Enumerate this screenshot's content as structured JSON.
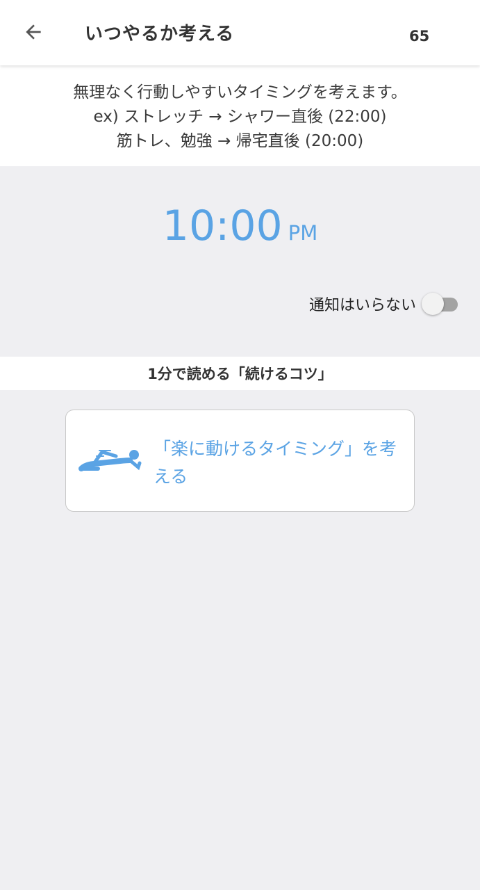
{
  "appbar": {
    "back_icon": "arrow-left-icon",
    "title": "いつやるか考える",
    "count": "65"
  },
  "intro": {
    "line1": "無理なく行動しやすいタイミングを考えます。",
    "line2": "ex) ストレッチ → シャワー直後 (22:00)",
    "line3": "筋トレ、勉強 → 帰宅直後 (20:00)"
  },
  "time": {
    "value": "10:00",
    "ampm": "PM"
  },
  "notification": {
    "label": "通知はいらない",
    "enabled": false
  },
  "tips": {
    "header": "1分で読める「続けるコツ」",
    "card_icon": "person-lying-icon",
    "card_text": "「楽に動けるタイミング」を考える"
  },
  "colors": {
    "accent": "#5aa3e4",
    "background": "#efeff2",
    "switch_track": "#a3a3a3"
  }
}
